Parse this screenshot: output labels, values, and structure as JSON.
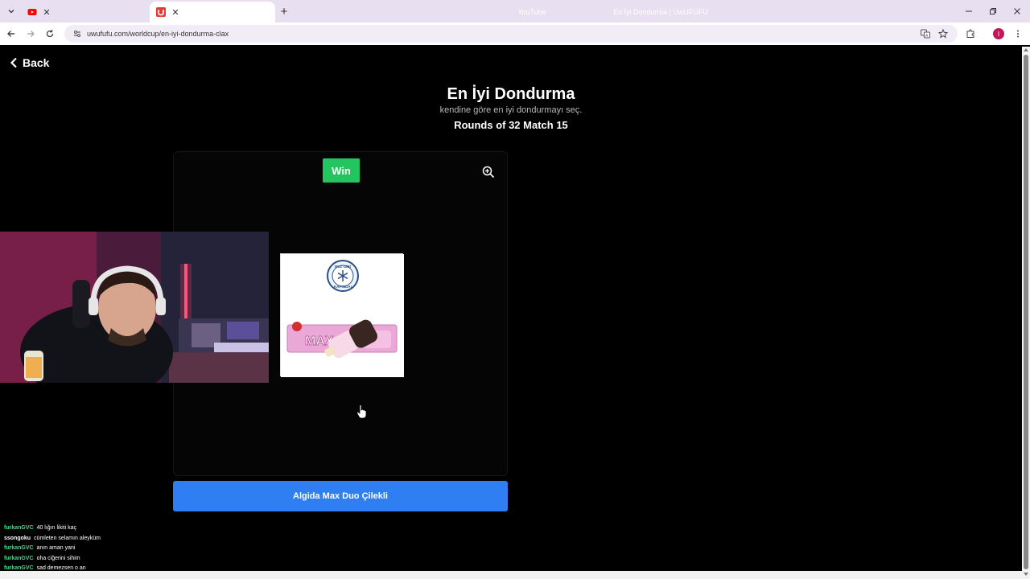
{
  "browser": {
    "tabs": [
      {
        "title": "YouTube",
        "favicon": "youtube-icon",
        "active": false
      },
      {
        "title": "En İyi Dondurma | UwUFUFU",
        "favicon": "uwufufu-icon",
        "active": true
      }
    ],
    "url": "uwufufu.com/worldcup/en-iyi-dondurma-clax",
    "profile_initial": "I",
    "accent_color": "#c2185b"
  },
  "page": {
    "back_label": "Back",
    "title": "En İyi Dondurma",
    "subtitle": "kendine göre en iyi dondurmayı seç.",
    "round_info": "Rounds of 32 Match 15",
    "win_badge": "Win",
    "choice_label": "Algida Max Duo Çilekli",
    "colors": {
      "win": "#22c55e",
      "choice_button": "#2f7ff3"
    }
  },
  "product_image": {
    "badge_top_text": "BUZ GİBİ",
    "badge_bottom_text": "KAPINDA!",
    "wrapper_text": "MAX"
  },
  "chat": [
    {
      "user": "furkanGVC",
      "message": "40 lığın likiti kaç"
    },
    {
      "user": "ssongoku",
      "message": "cümleten selamın aleyküm"
    },
    {
      "user": "furkanGVC",
      "message": "anın aman yani"
    },
    {
      "user": "furkanGVC",
      "message": "oha ciğerini sihim"
    },
    {
      "user": "furkanGVC",
      "message": "sad demezsen o an"
    }
  ]
}
